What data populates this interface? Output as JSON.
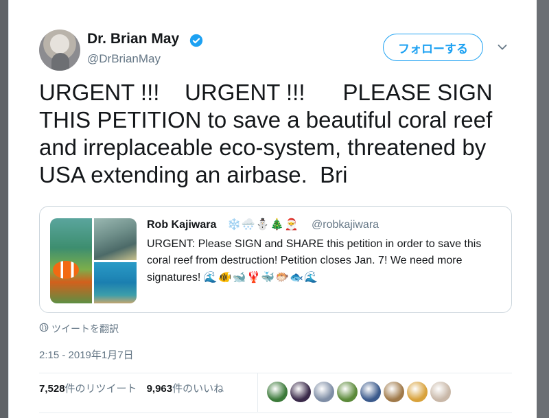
{
  "author": {
    "name": "Dr. Brian May",
    "handle": "@DrBrianMay",
    "verified_color": "#1da1f2"
  },
  "follow_button": {
    "label": "フォローする"
  },
  "tweet": {
    "text": "URGENT !!!    URGENT !!!      PLEASE SIGN THIS PETITION to save a beautiful coral reef and irreplaceable eco-system, threatened by USA extending an airbase.  Bri"
  },
  "quoted_tweet": {
    "author_name": "Rob Kajiwara",
    "name_emojis": "❄️🌨️⛄🎄🎅",
    "handle": "@robkajiwara",
    "text": "URGENT: Please SIGN and SHARE this petition in order to save this coral reef from destruction! Petition closes Jan. 7! We need more signatures!",
    "tail_emojis": "🌊🐠🐋🦞🐳🐡🐟🌊"
  },
  "translate_label": "ツイートを翻訳",
  "timestamp": "2:15 - 2019年1月7日",
  "stats": {
    "retweets_count": "7,528",
    "retweets_label": "件のリツイート",
    "likes_count": "9,963",
    "likes_label": "件のいいね"
  },
  "liker_avatar_colors": [
    "#3c7a3a",
    "#3a2a4a",
    "#7f8ea6",
    "#5c8a3a",
    "#3b5a8c",
    "#a07a4a",
    "#d8a23c",
    "#c9b8a8"
  ],
  "colors": {
    "accent": "#1da1f2",
    "text_primary": "#14171a",
    "text_secondary": "#657786"
  }
}
